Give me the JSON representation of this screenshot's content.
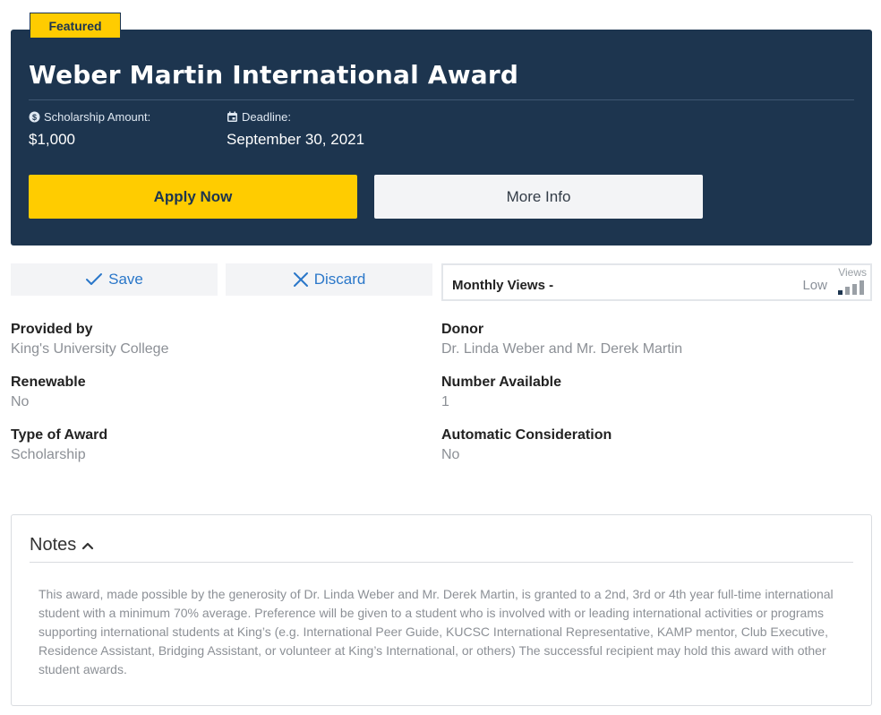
{
  "hero": {
    "badge": "Featured",
    "title": "Weber Martin International Award",
    "amount_label": "Scholarship Amount:",
    "amount_value": "$1,000",
    "deadline_label": "Deadline:",
    "deadline_value": "September 30, 2021",
    "apply_label": "Apply Now",
    "more_info_label": "More Info",
    "colors": {
      "background": "#1d354f",
      "accent": "#ffcc00"
    }
  },
  "actions": {
    "save_label": "Save",
    "discard_label": "Discard",
    "save_icon": "checkmark-icon",
    "discard_icon": "x-icon",
    "link_color": "#2a77c9"
  },
  "views": {
    "label": "Monthly Views -",
    "corner_label": "Views",
    "level": "Low",
    "level_value": 1,
    "level_max": 4
  },
  "details": {
    "provided_by": {
      "label": "Provided by",
      "value": "King's University College"
    },
    "donor": {
      "label": "Donor",
      "value": "Dr. Linda Weber and Mr. Derek Martin"
    },
    "renewable": {
      "label": "Renewable",
      "value": "No"
    },
    "number_available": {
      "label": "Number Available",
      "value": "1"
    },
    "type_of_award": {
      "label": "Type of Award",
      "value": "Scholarship"
    },
    "automatic_consideration": {
      "label": "Automatic Consideration",
      "value": "No"
    }
  },
  "notes": {
    "title": "Notes",
    "expanded": true,
    "body": "This award, made possible by the generosity of Dr. Linda Weber and Mr. Derek Martin, is granted to a 2nd, 3rd or 4th year full-time international student with a minimum 70% average. Preference will be given to a student who is involved with or leading international activities or programs supporting international students at King’s (e.g. International Peer Guide, KUCSC International Representative, KAMP mentor, Club Executive, Residence Assistant, Bridging Assistant, or volunteer at King’s International, or others) The successful recipient may hold this award with other student awards."
  }
}
